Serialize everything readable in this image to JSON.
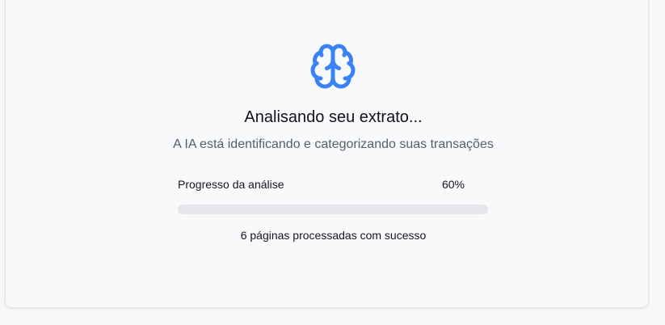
{
  "analysis": {
    "icon": "brain-icon",
    "title": "Analisando seu extrato...",
    "subtitle": "A IA está identificando e categorizando suas transações",
    "progress_label": "Progresso da análise",
    "progress_value_text": "60%",
    "progress_fraction": 0.6,
    "status_text": "6 páginas processadas com sucesso"
  },
  "colors": {
    "accent": "#3b82f6",
    "track": "#e4e6e9",
    "card_bg": "#f8f9fb",
    "text_primary": "#111318",
    "text_secondary": "#575e69"
  }
}
